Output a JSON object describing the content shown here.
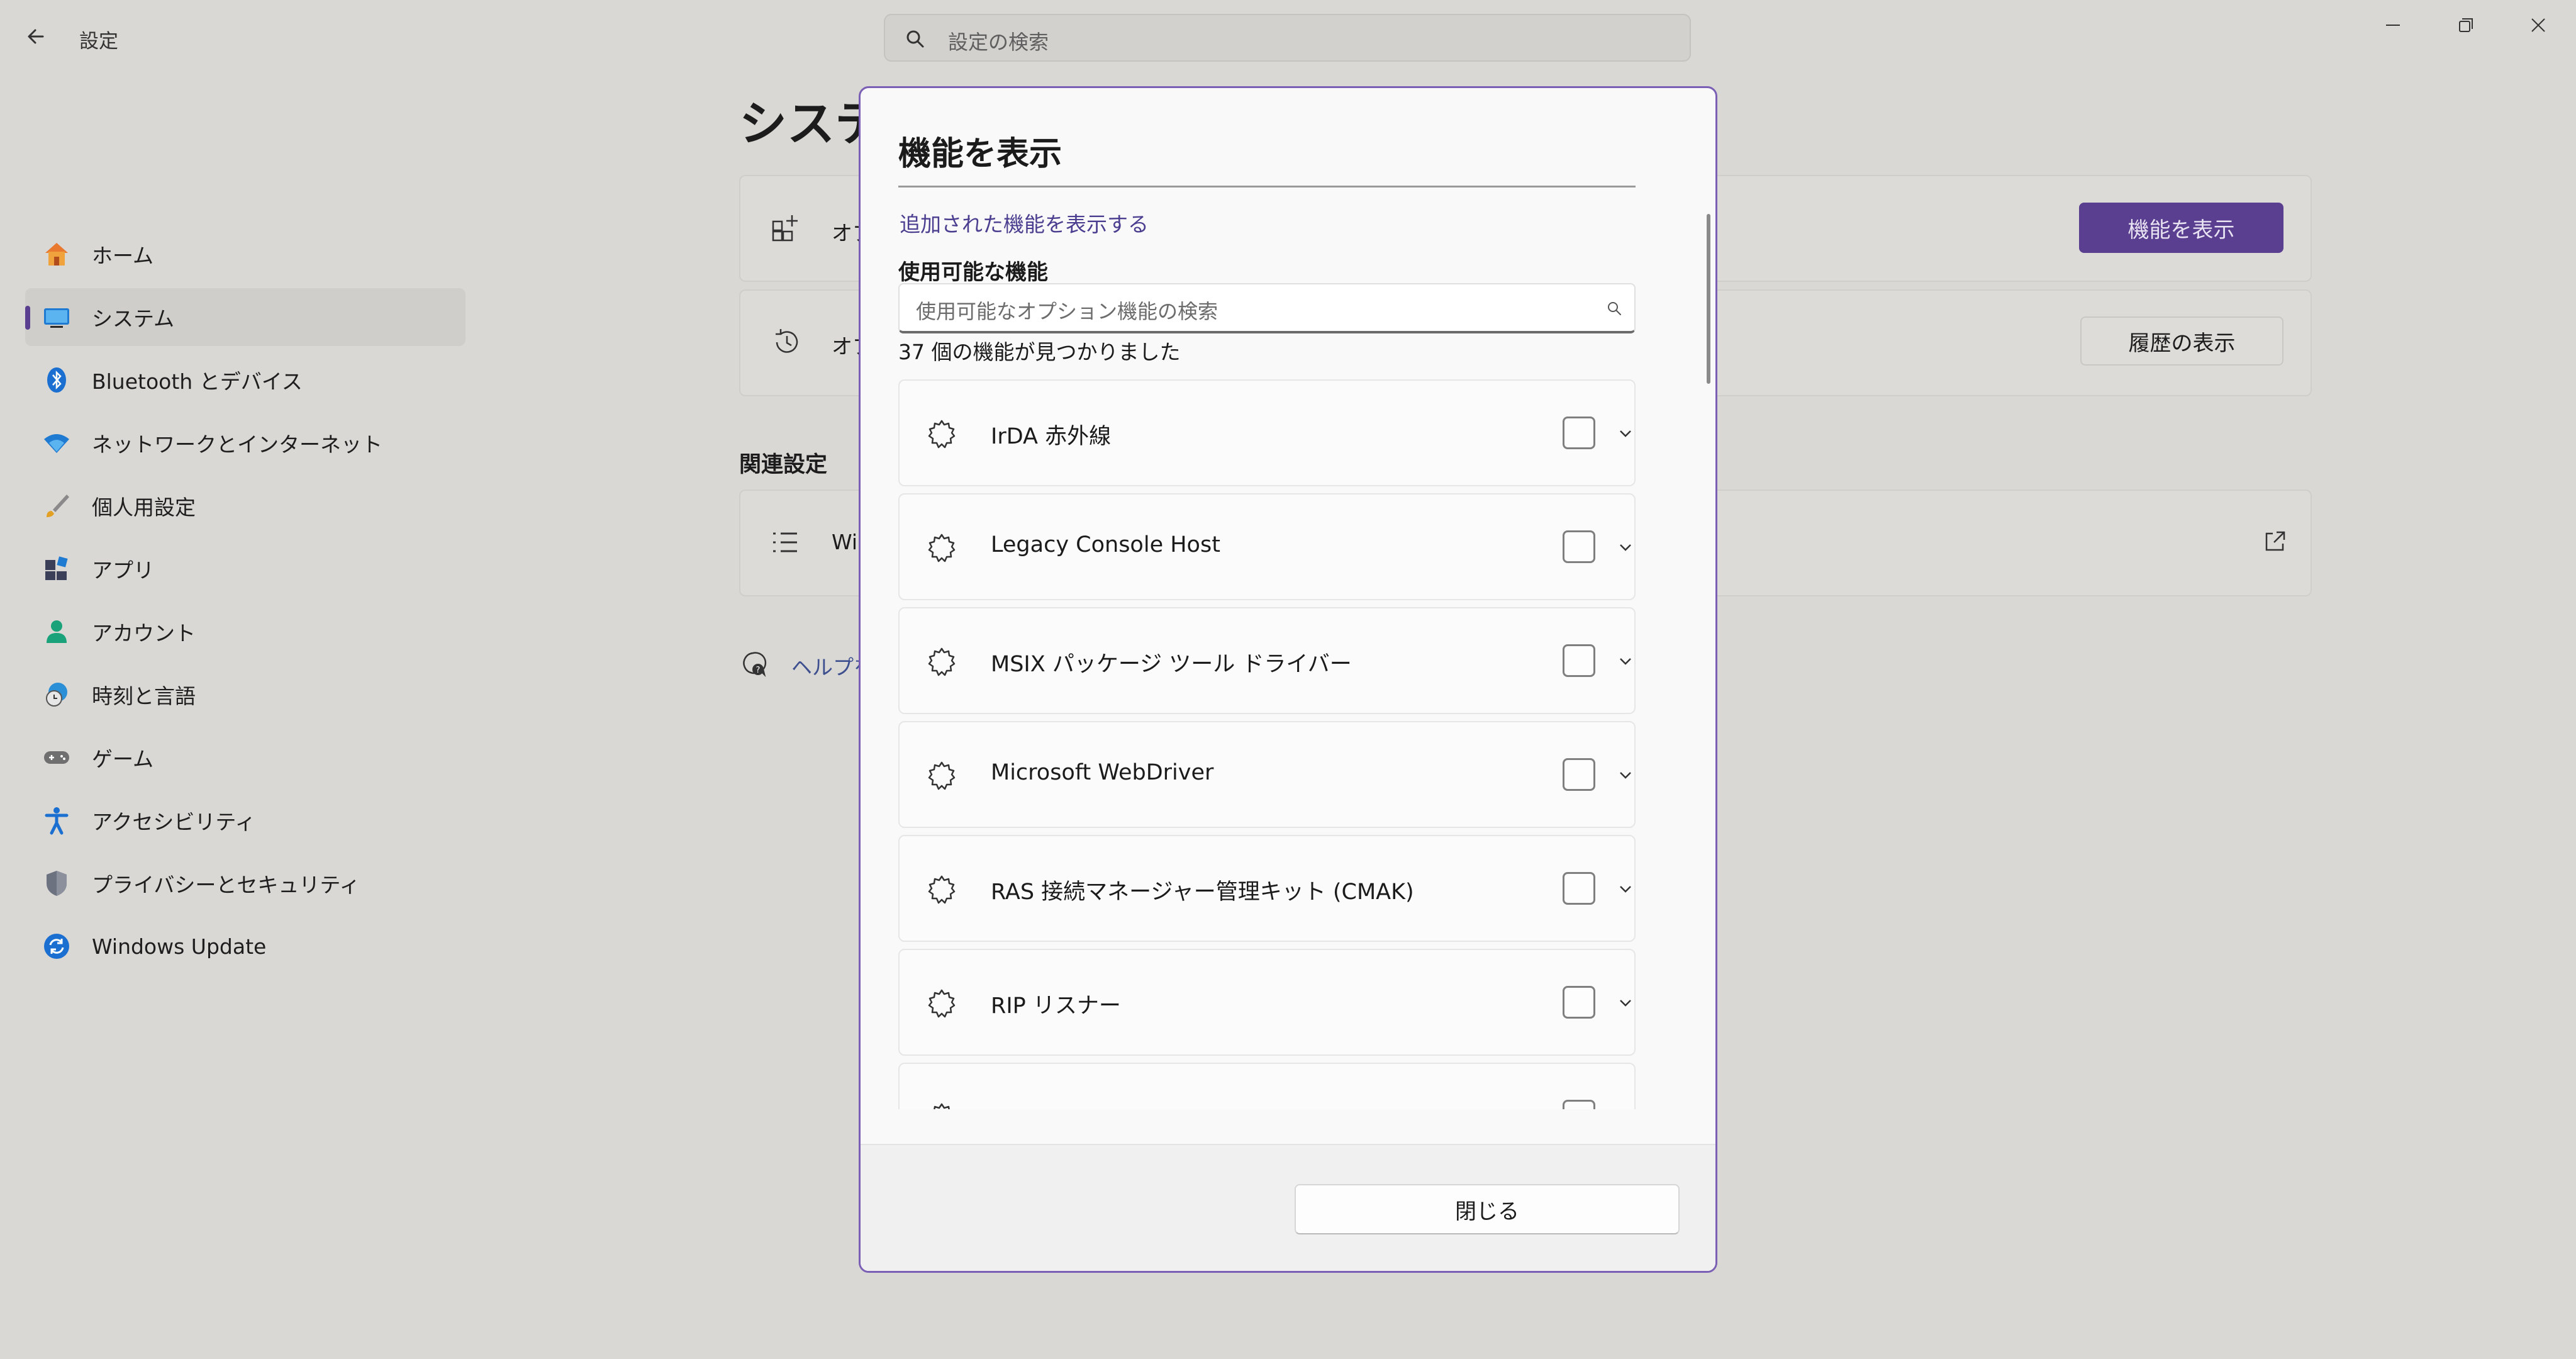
{
  "app": {
    "title": "設定"
  },
  "search": {
    "placeholder": "設定の検索"
  },
  "sidebar": {
    "items": [
      {
        "label": "ホーム",
        "icon": "home-icon"
      },
      {
        "label": "システム",
        "icon": "system-icon",
        "active": true
      },
      {
        "label": "Bluetooth とデバイス",
        "icon": "bluetooth-icon"
      },
      {
        "label": "ネットワークとインターネット",
        "icon": "wifi-icon"
      },
      {
        "label": "個人用設定",
        "icon": "brush-icon"
      },
      {
        "label": "アプリ",
        "icon": "apps-icon"
      },
      {
        "label": "アカウント",
        "icon": "account-icon"
      },
      {
        "label": "時刻と言語",
        "icon": "clock-globe-icon"
      },
      {
        "label": "ゲーム",
        "icon": "gamepad-icon"
      },
      {
        "label": "アクセシビリティ",
        "icon": "accessibility-icon"
      },
      {
        "label": "プライバシーとセキュリティ",
        "icon": "shield-icon"
      },
      {
        "label": "Windows Update",
        "icon": "update-icon"
      }
    ]
  },
  "page": {
    "title": "システム",
    "card1_text": "オプ",
    "card1_button": "機能を表示",
    "card2_text": "オプ",
    "card2_button": "履歴の表示",
    "related_heading": "関連設定",
    "card3_text": "Wi",
    "help_link": "ヘルプを"
  },
  "dialog": {
    "title": "機能を表示",
    "added_link": "追加された機能を表示する",
    "available_heading": "使用可能な機能",
    "search_placeholder": "使用可能なオプション機能の検索",
    "count_text": "37 個の機能が見つかりました",
    "features": [
      {
        "name": "IrDA 赤外線",
        "checked": false
      },
      {
        "name": "Legacy Console Host",
        "checked": false
      },
      {
        "name": "MSIX パッケージ ツール ドライバー",
        "checked": false
      },
      {
        "name": "Microsoft WebDriver",
        "checked": false
      },
      {
        "name": "RAS 接続マネージャー管理キット (CMAK)",
        "checked": false
      },
      {
        "name": "RIP リスナー",
        "checked": false
      }
    ],
    "close_button": "閉じる"
  },
  "colors": {
    "accent": "#5a3e8f",
    "link": "#4b3d8f",
    "dialog_border": "#7a5fb5"
  }
}
